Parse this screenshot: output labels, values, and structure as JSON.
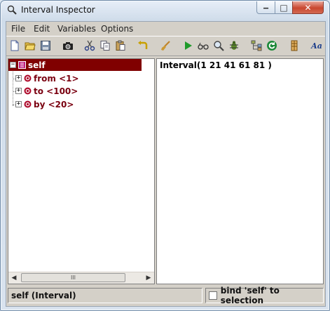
{
  "window": {
    "title": "Interval Inspector",
    "minimize_glyph": "‒",
    "maximize_glyph": "□",
    "close_glyph": "✕"
  },
  "menu": [
    "File",
    "Edit",
    "Variables",
    "Options"
  ],
  "toolbar": {
    "icons": [
      "new-icon",
      "open-icon",
      "save-icon",
      "camera-icon",
      "cut-icon",
      "copy-icon",
      "paste-icon",
      "undo-icon",
      "brush-icon",
      "run-icon",
      "inspect-glasses-icon",
      "search-icon",
      "debug-bug-icon",
      "hierarchy-icon",
      "refresh-icon",
      "browser-icon",
      "font-icon"
    ],
    "font_glyph": "Aa"
  },
  "tree": {
    "expand_glyph": "−",
    "collapsed_glyph": "+",
    "root_label": "self",
    "children": [
      "from <1>",
      "to <100>",
      "by <20>"
    ]
  },
  "value_pane": {
    "text": "Interval(1 21 41 61 81 )"
  },
  "scrollbar": {
    "left_glyph": "◀",
    "right_glyph": "▶",
    "thumb_glyph": "III"
  },
  "status": {
    "text": "self (Interval)",
    "bind_label": "bind 'self' to selection",
    "bind_checked": false
  },
  "colors": {
    "selection": "#800000",
    "child_text": "#7a0010"
  }
}
